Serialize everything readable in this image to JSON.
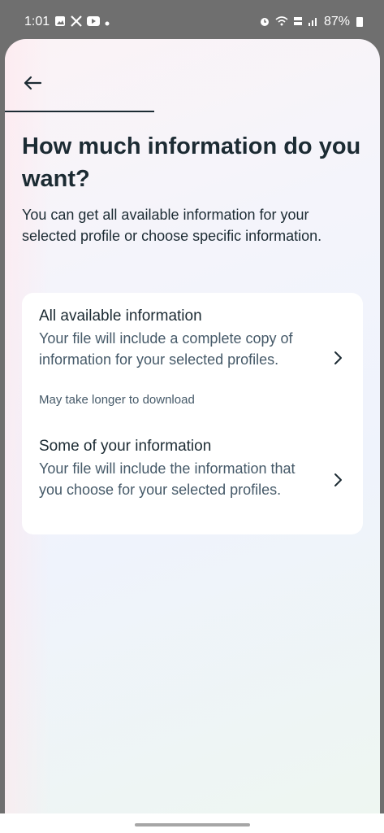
{
  "status_bar": {
    "time": "1:01",
    "battery": "87%"
  },
  "page": {
    "title": "How much information do you want?",
    "subtitle": "You can get all available information for your selected profile or choose specific information."
  },
  "options": [
    {
      "title": "All available information",
      "description": "Your file will include a complete copy of information for your selected profiles.",
      "note": "May take longer to download"
    },
    {
      "title": "Some of your information",
      "description": "Your file will include the information that you choose for your selected profiles."
    }
  ],
  "icons": {
    "back": "arrow-left-icon",
    "chevron": "chevron-right-icon"
  },
  "colors": {
    "text_primary": "#1c2b33",
    "text_secondary": "#465a69",
    "card": "#ffffff"
  }
}
